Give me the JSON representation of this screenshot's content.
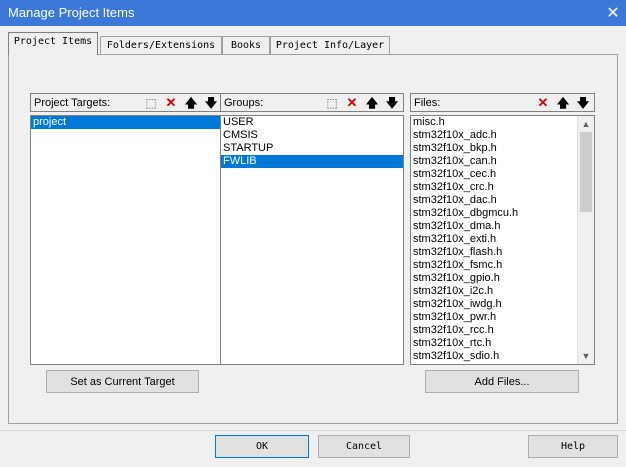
{
  "window": {
    "title": "Manage Project Items",
    "close_glyph": "✕"
  },
  "tabs": [
    {
      "label": "Project Items",
      "active": true
    },
    {
      "label": "Folders/Extensions",
      "active": false
    },
    {
      "label": "Books",
      "active": false
    },
    {
      "label": "Project Info/Layer",
      "active": false
    }
  ],
  "project_targets": {
    "label": "Project Targets:",
    "items": [
      "project"
    ],
    "selected": "project",
    "toolbar": [
      "new-icon",
      "delete-icon",
      "move-up-icon",
      "move-down-icon"
    ]
  },
  "groups": {
    "label": "Groups:",
    "items": [
      "USER",
      "CMSIS",
      "STARTUP",
      "FWLIB"
    ],
    "selected": "FWLIB",
    "toolbar": [
      "new-icon",
      "delete-icon",
      "move-up-icon",
      "move-down-icon"
    ]
  },
  "files": {
    "label": "Files:",
    "items": [
      "misc.h",
      "stm32f10x_adc.h",
      "stm32f10x_bkp.h",
      "stm32f10x_can.h",
      "stm32f10x_cec.h",
      "stm32f10x_crc.h",
      "stm32f10x_dac.h",
      "stm32f10x_dbgmcu.h",
      "stm32f10x_dma.h",
      "stm32f10x_exti.h",
      "stm32f10x_flash.h",
      "stm32f10x_fsmc.h",
      "stm32f10x_gpio.h",
      "stm32f10x_i2c.h",
      "stm32f10x_iwdg.h",
      "stm32f10x_pwr.h",
      "stm32f10x_rcc.h",
      "stm32f10x_rtc.h",
      "stm32f10x_sdio.h"
    ],
    "toolbar": [
      "delete-icon",
      "move-up-icon",
      "move-down-icon"
    ]
  },
  "glyphs": {
    "new": "⬚",
    "delete": "✕",
    "up": "🡅",
    "down": "🡇",
    "scroll_up": "▲",
    "scroll_down": "▼"
  },
  "buttons": {
    "set_current_target": "Set as Current Target",
    "add_files": "Add Files...",
    "ok": "OK",
    "cancel": "Cancel",
    "help": "Help"
  },
  "colors": {
    "title_bar": "#3b78d8",
    "selection": "#0078d7",
    "delete_icon": "#d00000"
  }
}
